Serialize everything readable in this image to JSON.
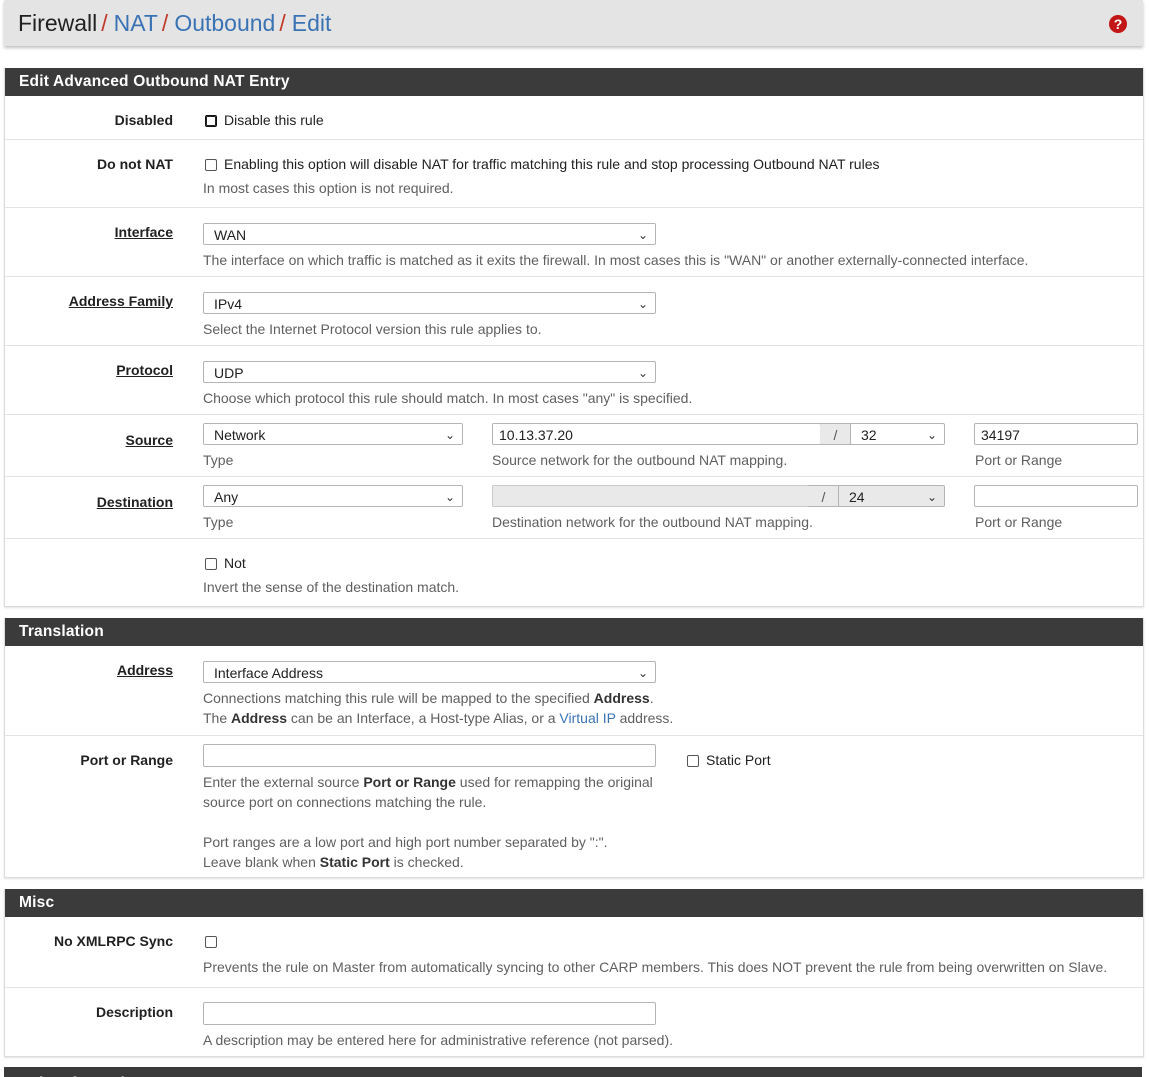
{
  "breadcrumb": {
    "root": "Firewall",
    "items": [
      "NAT",
      "Outbound",
      "Edit"
    ],
    "separator": "/",
    "help_icon": "question-circle-icon"
  },
  "panel_edit": {
    "title": "Edit Advanced Outbound NAT Entry",
    "disabled": {
      "label": "Disabled",
      "checkbox_text": "Disable this rule"
    },
    "donotnat": {
      "label": "Do not NAT",
      "checkbox_text": "Enabling this option will disable NAT for traffic matching this rule and stop processing Outbound NAT rules",
      "help": "In most cases this option is not required."
    },
    "interface": {
      "label": "Interface",
      "value": "WAN",
      "help": "The interface on which traffic is matched as it exits the firewall. In most cases this is \"WAN\" or another externally-connected interface."
    },
    "address_family": {
      "label": "Address Family",
      "value": "IPv4",
      "help": "Select the Internet Protocol version this rule applies to."
    },
    "protocol": {
      "label": "Protocol",
      "value": "UDP",
      "help": "Choose which protocol this rule should match. In most cases \"any\" is specified."
    },
    "source": {
      "label": "Source",
      "type_value": "Network",
      "type_help": "Type",
      "network_value": "10.13.37.20",
      "slash": "/",
      "mask_value": "32",
      "network_help": "Source network for the outbound NAT mapping.",
      "port_value": "34197",
      "port_help": "Port or Range"
    },
    "destination": {
      "label": "Destination",
      "type_value": "Any",
      "type_help": "Type",
      "network_value": "",
      "slash": "/",
      "mask_value": "24",
      "network_help": "Destination network for the outbound NAT mapping.",
      "port_value": "",
      "port_help": "Port or Range"
    },
    "not": {
      "checkbox_text": "Not",
      "help": "Invert the sense of the destination match."
    }
  },
  "panel_translation": {
    "title": "Translation",
    "address": {
      "label": "Address",
      "value": "Interface Address",
      "help1_a": "Connections matching this rule will be mapped to the specified ",
      "help1_b": "Address",
      "help1_c": ".",
      "help2_a": "The ",
      "help2_b": "Address",
      "help2_c": " can be an Interface, a Host-type Alias, or a ",
      "help2_link": "Virtual IP",
      "help2_d": " address."
    },
    "port": {
      "label": "Port or Range",
      "value": "",
      "static_port": "Static Port",
      "help1_a": "Enter the external source ",
      "help1_b": "Port or Range",
      "help1_c": " used for remapping the original",
      "help2": "source port on connections matching the rule.",
      "help3": "Port ranges are a low port and high port number separated by \":\".",
      "help4_a": "Leave blank when ",
      "help4_b": "Static Port",
      "help4_c": " is checked."
    }
  },
  "panel_misc": {
    "title": "Misc",
    "xmlrpc": {
      "label": "No XMLRPC Sync",
      "help": "Prevents the rule on Master from automatically syncing to other CARP members. This does NOT prevent the rule from being overwritten on Slave."
    },
    "description": {
      "label": "Description",
      "value": "",
      "help": "A description may be entered here for administrative reference (not parsed)."
    }
  },
  "panel_rule_info": {
    "title": "Rule Information"
  }
}
